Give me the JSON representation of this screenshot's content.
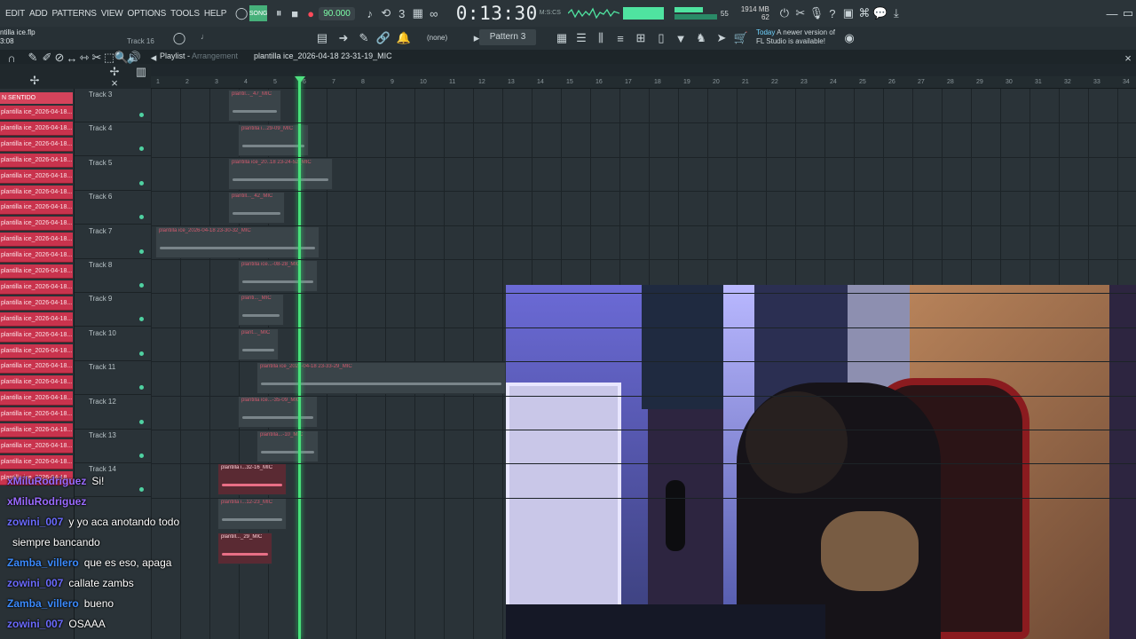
{
  "app": {
    "menus": [
      "EDIT",
      "ADD",
      "PATTERNS",
      "VIEW",
      "OPTIONS",
      "TOOLS",
      "HELP"
    ],
    "tempo": "90.000",
    "time": "0:13:30",
    "time_unit": "M:S:CS",
    "cpu_value": "55",
    "memory": "1914 MB",
    "memory_sub": "62",
    "pattern": "Pattern 3",
    "channel_none": "(none)",
    "news_today": "Today",
    "news_text": "A newer version of",
    "news_text2": "FL Studio is available!",
    "project_file": "ntilla ice.flp",
    "project_time": "3:08",
    "focused_track": "Track 16",
    "snap": "♩"
  },
  "playlist": {
    "title": "Playlist",
    "subtitle": "Arrangement",
    "file": "plantilla ice_2026-04-18 23-31-19_MIC",
    "bars": [
      "1",
      "2",
      "3",
      "4",
      "5",
      "6",
      "7",
      "8",
      "9",
      "10",
      "11",
      "12",
      "13",
      "14",
      "15",
      "16",
      "17",
      "18",
      "19",
      "20",
      "21",
      "22",
      "23",
      "24",
      "25",
      "26",
      "27",
      "28",
      "29",
      "30",
      "31",
      "32",
      "33",
      "34"
    ]
  },
  "picker": {
    "header": "N SENTIDO",
    "items": [
      "plantilla ice_2026-04-18...",
      "plantilla ice_2026-04-18...",
      "plantilla ice_2026-04-18...",
      "plantilla ice_2026-04-18...",
      "plantilla ice_2026-04-18...",
      "plantilla ice_2026-04-18...",
      "plantilla ice_2026-04-18...",
      "plantilla ice_2026-04-18...",
      "plantilla ice_2026-04-18...",
      "plantilla ice_2026-04-18...",
      "plantilla ice_2026-04-18...",
      "plantilla ice_2026-04-18...",
      "plantilla ice_2026-04-18...",
      "plantilla ice_2026-04-18...",
      "plantilla ice_2026-04-18...",
      "plantilla ice_2026-04-18...",
      "plantilla ice_2026-04-18...",
      "plantilla ice_2026-04-18...",
      "plantilla ice_2026-04-18...",
      "plantilla ice_2026-04-18...",
      "plantilla ice_2026-04-18...",
      "plantilla ice_2026-04-18...",
      "plantilla ice_2026-04-18...",
      "plantilla ice_2026-04-18..."
    ]
  },
  "tracks": [
    "Track 3",
    "Track 4",
    "Track 5",
    "Track 6",
    "Track 7",
    "Track 8",
    "Track 9",
    "Track 10",
    "Track 11",
    "Track 12",
    "Track 13",
    "Track 14"
  ],
  "clips": [
    {
      "label": "plantil..._47_MIC",
      "style": "grey"
    },
    {
      "label": "plantilla i...29-09_MIC",
      "style": "grey"
    },
    {
      "label": "plantilla ice_20..18 23-24-52_MIC",
      "style": "grey"
    },
    {
      "label": "plantill..._42_MIC",
      "style": "grey"
    },
    {
      "label": "plantilla ice_2026-04-18 23-30-32_MIC",
      "style": "grey"
    },
    {
      "label": "plantilla ice...-08-28_MIC",
      "style": "grey"
    },
    {
      "label": "planti..._MIC",
      "style": "grey"
    },
    {
      "label": "plant..._MIC",
      "style": "grey"
    },
    {
      "label": "plantilla ice_2026-04-18 23-33-29_MIC",
      "style": "grey"
    },
    {
      "label": "plantilla ice...-35-09_MIC",
      "style": "grey"
    },
    {
      "label": "plantilla...-10_MIC",
      "style": "grey"
    },
    {
      "label": "plantilla i...32-16_MIC",
      "style": "red"
    },
    {
      "label": "plantilla i...12-23_MIC",
      "style": "grey"
    },
    {
      "label": "plantill..._29_MIC",
      "style": "red"
    }
  ],
  "chat": [
    {
      "user": "xMiluRodriguez",
      "text": "Si!",
      "color": "#9a6bff"
    },
    {
      "user": "xMiluRodriguez",
      "text": "",
      "color": "#9a6bff"
    },
    {
      "user": "zowini_007",
      "text": "y yo aca anotando todo",
      "color": "#6b6bff"
    },
    {
      "user": "",
      "text": "siempre bancando",
      "color": "#6b6bff"
    },
    {
      "user": "Zamba_villero",
      "text": "que es eso, apaga",
      "color": "#3b8bff"
    },
    {
      "user": "zowini_007",
      "text": "callate zambs",
      "color": "#6b6bff"
    },
    {
      "user": "Zamba_villero",
      "text": "bueno",
      "color": "#3b8bff"
    },
    {
      "user": "zowini_007",
      "text": "OSAAA",
      "color": "#6b6bff"
    }
  ],
  "colors": {
    "accent": "#48e07a",
    "clip_red": "#c9334d",
    "bg": "#2a3338"
  }
}
